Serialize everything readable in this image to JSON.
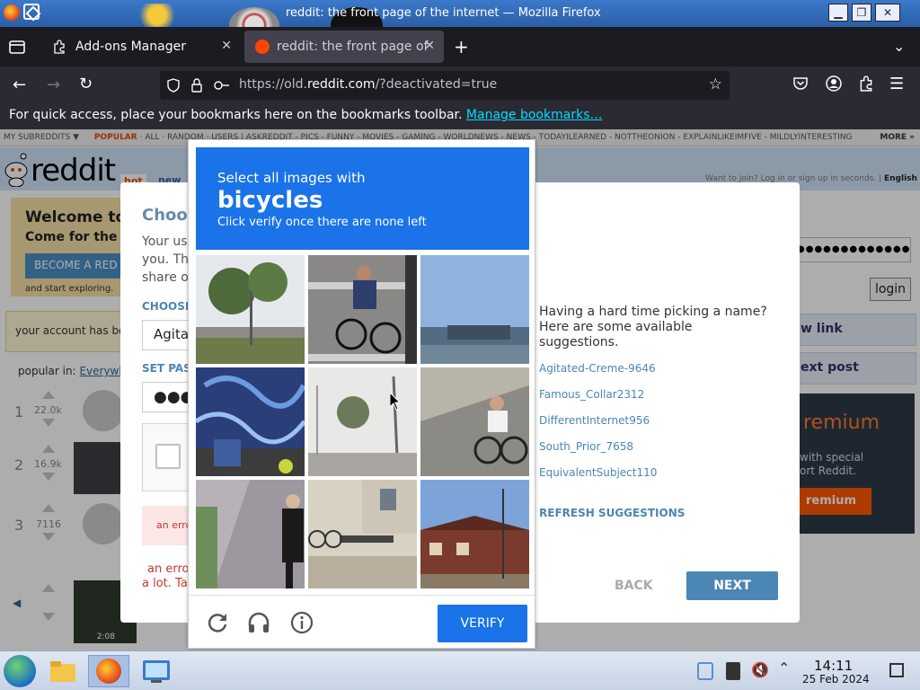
{
  "window": {
    "title": "reddit: the front page of the internet — Mozilla Firefox"
  },
  "tabs": [
    {
      "label": "Add-ons Manager"
    },
    {
      "label": "reddit: the front page of"
    }
  ],
  "urlbar": {
    "prefix": "https://old.",
    "domain": "reddit.com",
    "suffix": "/?deactivated=true"
  },
  "bookmarks_bar": {
    "text": "For quick access, place your bookmarks here on the bookmarks toolbar.",
    "link": "Manage bookmarks…"
  },
  "reddit": {
    "subreddit_bar": "MY SUBREDDITS ▼",
    "popular": "POPULAR",
    "nav_items": "· ALL · RANDOM · USERS | ASKREDDIT - PICS - FUNNY - MOVIES - GAMING - WORLDNEWS - NEWS - TODAYILEARNED - NOTTHEONION - EXPLAINLIKEIMFIVE - MILDLYINTERESTING",
    "more": "MORE »",
    "logo": "reddit",
    "tab_hot": "hot",
    "tab_new": "new",
    "join_text": "Want to join? Log in or sign up in seconds. |",
    "language": "English",
    "welcome_title": "Welcome to",
    "welcome_sub": "Come for the ca",
    "become_btn": "BECOME A RED",
    "explore": "and start exploring.",
    "deactivated_msg": "your account has bee",
    "popular_in": "popular in:",
    "popular_in_link": "Everywhe",
    "login_label": "login",
    "password_mask": "●●●●●●●●●●●●●",
    "new_link": "w link",
    "text_post": "ext post",
    "premium_title": "remium",
    "premium_text1": "with special",
    "premium_text2": "ort Reddit.",
    "premium_btn": "remium",
    "posts": [
      {
        "rank": "1",
        "score": "22.0k"
      },
      {
        "rank": "2",
        "score": "16.9k"
      },
      {
        "rank": "3",
        "score": "7116"
      }
    ],
    "video_duration": "2:08"
  },
  "signup_modal": {
    "title": "Choos",
    "para_lines": [
      "Your use",
      "you. Thi",
      "share or"
    ],
    "choose_label": "CHOOSE",
    "username_value": "Agitat",
    "set_pass_label": "SET PAS",
    "password_value": "●●●",
    "error_box": "an erro",
    "error_text_lines": [
      "an error",
      "a lot. Tak"
    ],
    "suggest_header": "Having a hard time picking a name? Here are some available suggestions.",
    "suggestions": [
      "Agitated-Creme-9646",
      "Famous_Collar2312",
      "DifferentInternet956",
      "South_Prior_7658",
      "EquivalentSubject110"
    ],
    "refresh": "REFRESH SUGGESTIONS",
    "back": "BACK",
    "next": "NEXT"
  },
  "captcha": {
    "line1": "Select all images with",
    "target": "bicycles",
    "line3": "Click verify once there are none left",
    "verify": "VERIFY",
    "tiles": [
      {
        "name": "trees-street",
        "bicycle": false
      },
      {
        "name": "cyclist-crosswalk",
        "bicycle": true
      },
      {
        "name": "harbor-scene",
        "bicycle": false
      },
      {
        "name": "graffiti-wall",
        "bicycle": true
      },
      {
        "name": "trees-foggy-street",
        "bicycle": false
      },
      {
        "name": "cyclist-road",
        "bicycle": true
      },
      {
        "name": "man-walking-sidewalk",
        "bicycle": false
      },
      {
        "name": "bench-building",
        "bicycle": true
      },
      {
        "name": "red-building",
        "bicycle": false
      }
    ]
  },
  "taskbar": {
    "time": "14:11",
    "date": "25 Feb 2024"
  },
  "colors": {
    "captcha_blue": "#1a73e8",
    "reddit_blue": "#4b86b4",
    "firefox_dark": "#1c1b22"
  }
}
